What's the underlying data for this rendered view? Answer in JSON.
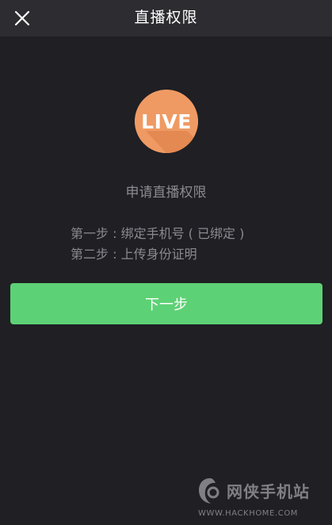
{
  "header": {
    "title": "直播权限",
    "close_icon": "close-icon"
  },
  "badge": {
    "text": "LIVE",
    "color": "#ef9a63"
  },
  "main": {
    "heading": "申请直播权限",
    "steps": [
      "第一步 : 绑定手机号 ( 已绑定 )",
      "第二步 : 上传身份证明"
    ],
    "next_button": "下一步",
    "accent_color": "#5dd175"
  },
  "watermark": {
    "name": "网侠手机站",
    "url": "WWW.HACKHOME.COM"
  }
}
